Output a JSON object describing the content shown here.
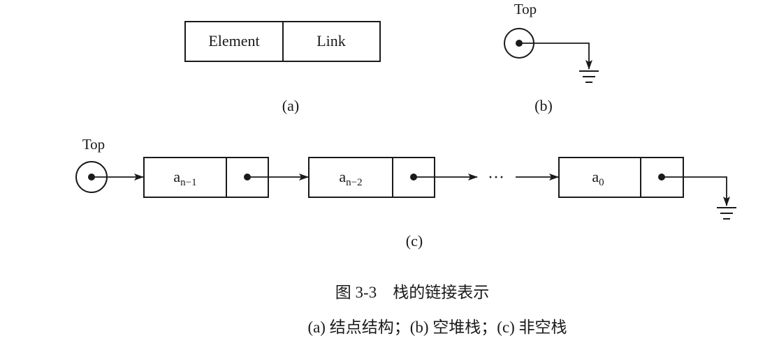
{
  "panel_a": {
    "node_fields": [
      "Element",
      "Link"
    ],
    "label": "(a)"
  },
  "panel_b": {
    "pointer_label": "Top",
    "label": "(b)"
  },
  "panel_c": {
    "pointer_label": "Top",
    "nodes": [
      {
        "base": "a",
        "subscript": "n−1"
      },
      {
        "base": "a",
        "subscript": "n−2"
      },
      {
        "base": "a",
        "subscript": "0"
      }
    ],
    "ellipsis": "···",
    "label": "(c)"
  },
  "caption": {
    "title": "图 3-3　栈的链接表示",
    "subtitle": "(a) 结点结构；(b) 空堆栈；(c) 非空栈"
  }
}
